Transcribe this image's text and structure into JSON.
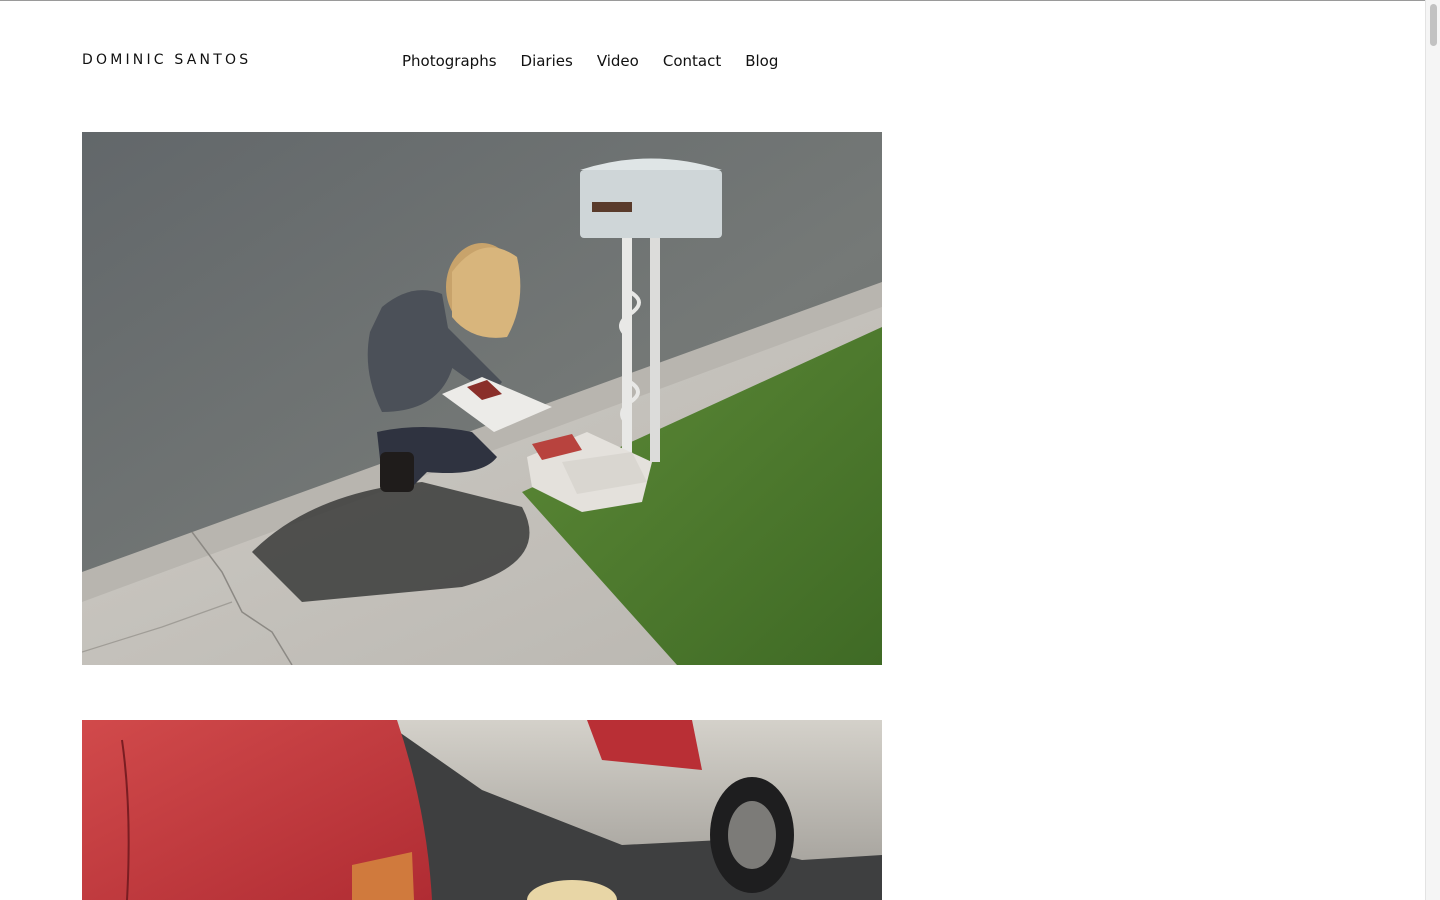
{
  "site": {
    "title": "DOMINIC SANTOS"
  },
  "nav": {
    "items": [
      {
        "label": "Photographs"
      },
      {
        "label": "Diaries"
      },
      {
        "label": "Video"
      },
      {
        "label": "Contact"
      },
      {
        "label": "Blog"
      }
    ]
  },
  "colors": {
    "background": "#ffffff",
    "text": "#111111",
    "asphalt": "#6f7372",
    "grass": "#4f7a2f",
    "concrete": "#c9c6c0",
    "red_car": "#c8383d",
    "silver_car": "#bdbab3"
  }
}
